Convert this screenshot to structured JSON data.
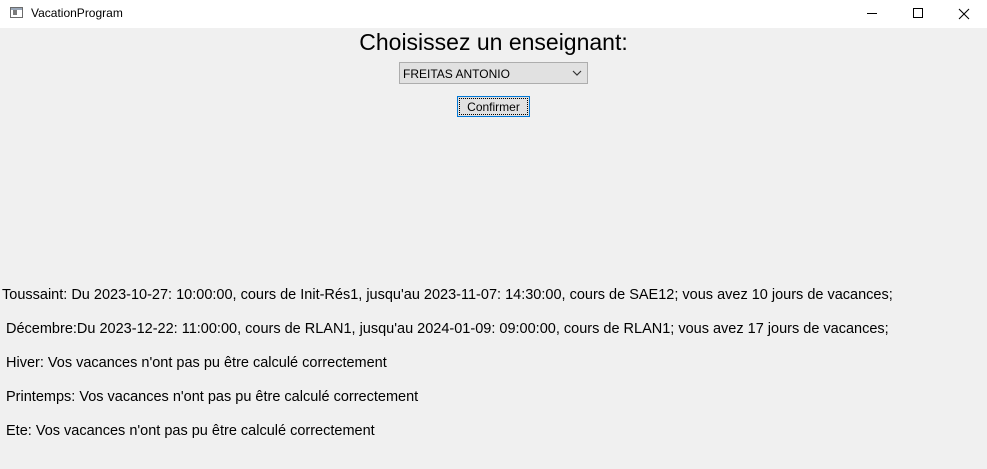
{
  "window": {
    "title": "VacationProgram"
  },
  "heading": "Choisissez un enseignant:",
  "teacher_select": {
    "selected": "FREITAS ANTONIO"
  },
  "confirm_label": "Confirmer",
  "results": [
    "Toussaint: Du 2023-10-27: 10:00:00, cours de Init-Rés1, jusqu'au 2023-11-07: 14:30:00, cours de SAE12; vous avez 10 jours de vacances;",
    "Décembre:Du 2023-12-22: 11:00:00, cours de RLAN1, jusqu'au 2024-01-09: 09:00:00, cours de RLAN1; vous avez 17 jours de vacances;",
    "Hiver: Vos vacances n'ont pas pu être calculé correctement",
    "Printemps: Vos vacances n'ont pas pu être calculé correctement",
    "Ete: Vos vacances n'ont pas pu être calculé correctement"
  ],
  "icons": {
    "app": "app-window-icon",
    "minimize": "minimize-icon",
    "maximize": "maximize-icon",
    "close": "close-icon",
    "dropdown": "chevron-down-icon"
  }
}
